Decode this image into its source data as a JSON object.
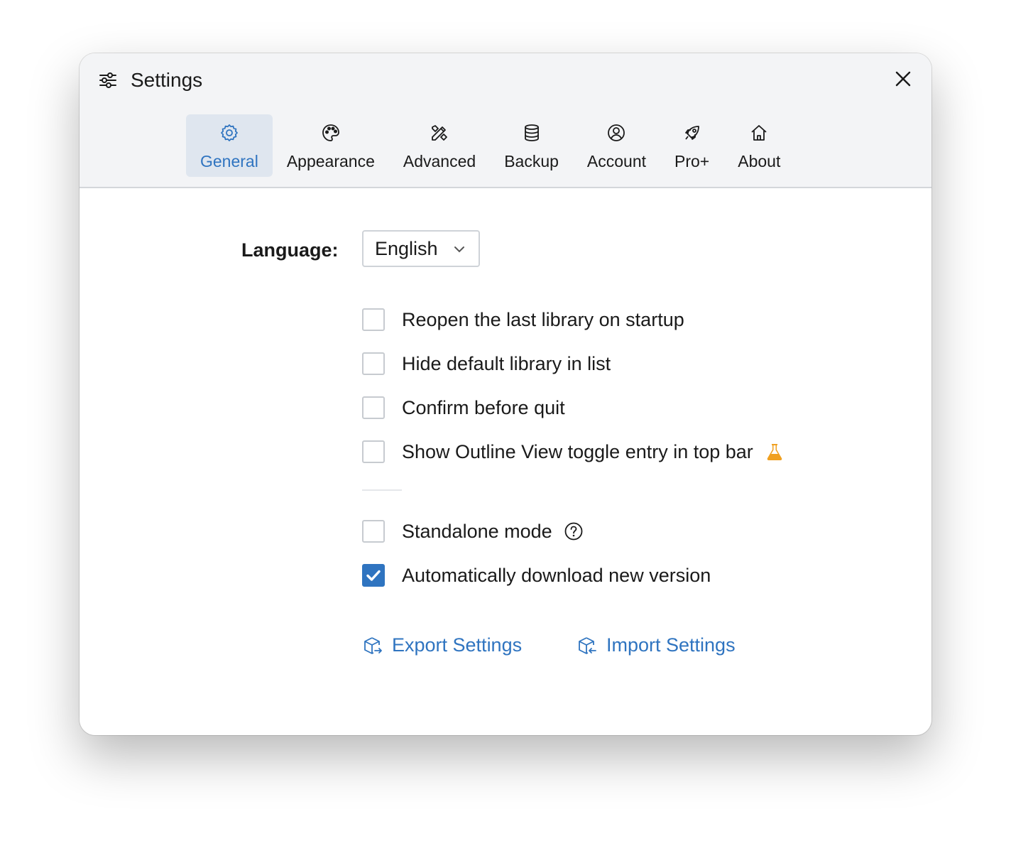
{
  "window": {
    "title": "Settings"
  },
  "tabs": [
    {
      "label": "General",
      "icon": "gear-icon",
      "active": true
    },
    {
      "label": "Appearance",
      "icon": "palette-icon",
      "active": false
    },
    {
      "label": "Advanced",
      "icon": "tools-icon",
      "active": false
    },
    {
      "label": "Backup",
      "icon": "database-icon",
      "active": false
    },
    {
      "label": "Account",
      "icon": "user-circle-icon",
      "active": false
    },
    {
      "label": "Pro+",
      "icon": "rocket-icon",
      "active": false
    },
    {
      "label": "About",
      "icon": "home-icon",
      "active": false
    }
  ],
  "language": {
    "label": "Language:",
    "value": "English"
  },
  "options": [
    {
      "label": "Reopen the last library on startup",
      "checked": false
    },
    {
      "label": "Hide default library in list",
      "checked": false
    },
    {
      "label": "Confirm before quit",
      "checked": false
    },
    {
      "label": "Show Outline View toggle entry in top bar",
      "checked": false,
      "badge_icon": "flask-icon"
    },
    {
      "label": "Standalone mode",
      "checked": false,
      "help_icon": "question-circle-icon"
    },
    {
      "label": "Automatically download new version",
      "checked": true
    }
  ],
  "actions": {
    "export_label": "Export Settings",
    "import_label": "Import Settings"
  },
  "colors": {
    "accent": "#2f74c0",
    "header_bg": "#f3f4f6",
    "active_tab_bg": "#dfe6ef",
    "flask": "#f0a020"
  }
}
